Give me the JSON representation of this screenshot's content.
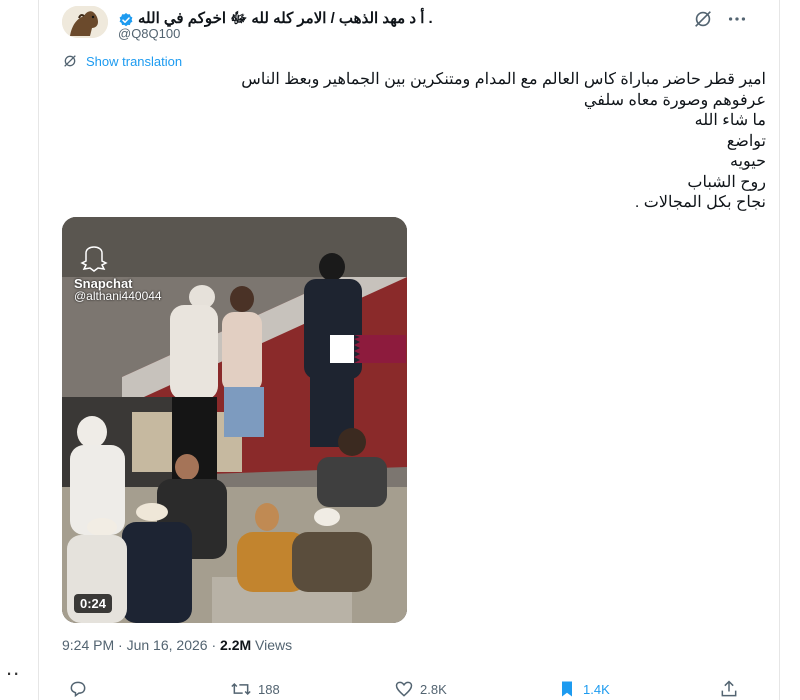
{
  "author": {
    "display_name": ". أ د مهد الذهب / الامر كله لله ﷻ اخوكم في الله",
    "handle": "@Q8Q100"
  },
  "translation": {
    "label": "Show translation"
  },
  "tweet": {
    "lines": [
      "امير قطر حاضر مباراة كاس العالم مع المدام ومتنكرين بين الجماهير وبعظ الناس",
      "عرفوهم وصورة معاه سلفي",
      "ما شاء الله",
      "تواضع",
      "حيويه",
      "روح الشباب",
      "نجاح بكل المجالات ."
    ]
  },
  "media": {
    "watermark_brand": "Snapchat",
    "watermark_handle": "@althani440044",
    "duration": "0:24"
  },
  "meta": {
    "time": "9:24 PM",
    "separator": "·",
    "date": "Jun 16, 2026",
    "views_count": "2.2M",
    "views_label": "Views"
  },
  "actions": {
    "replies": "",
    "reposts": "188",
    "likes": "2.8K",
    "bookmarks": "1.4K"
  },
  "stray_dots": "..",
  "colors": {
    "accent": "#1d9bf0",
    "muted": "#536471",
    "text": "#0f1419"
  },
  "icons": [
    "verified-icon",
    "grok-icon",
    "more-icon",
    "translate-icon",
    "reply-icon",
    "repost-icon",
    "like-icon",
    "bookmark-icon",
    "share-icon",
    "snapchat-ghost-icon"
  ]
}
